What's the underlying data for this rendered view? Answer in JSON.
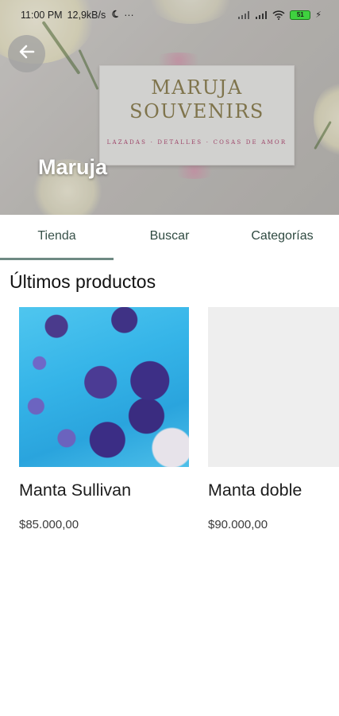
{
  "status_bar": {
    "time": "11:00 PM",
    "speed": "12,9kB/s",
    "moon_icon": "moon-icon",
    "more": "···",
    "battery": "51",
    "charging_icon": "bolt-icon"
  },
  "header": {
    "back_icon": "arrow-left-icon",
    "shop_name": "Maruja",
    "banner": {
      "title_line1": "MARUJA",
      "title_line2": "SOUVENIRS",
      "subtitle": "LAZADAS · DETALLES · COSAS DE AMOR"
    }
  },
  "tabs": [
    {
      "label": "Tienda",
      "active": true
    },
    {
      "label": "Buscar",
      "active": false
    },
    {
      "label": "Categorías",
      "active": false
    }
  ],
  "section": {
    "title": "Últimos productos"
  },
  "products": [
    {
      "name": "Manta Sullivan",
      "price": "$85.000,00"
    },
    {
      "name": "Manta doble",
      "price": "$90.000,00"
    }
  ],
  "colors": {
    "tab_indicator": "#6e8a83",
    "tab_text": "#2f4a41",
    "battery": "#3fd23f"
  }
}
